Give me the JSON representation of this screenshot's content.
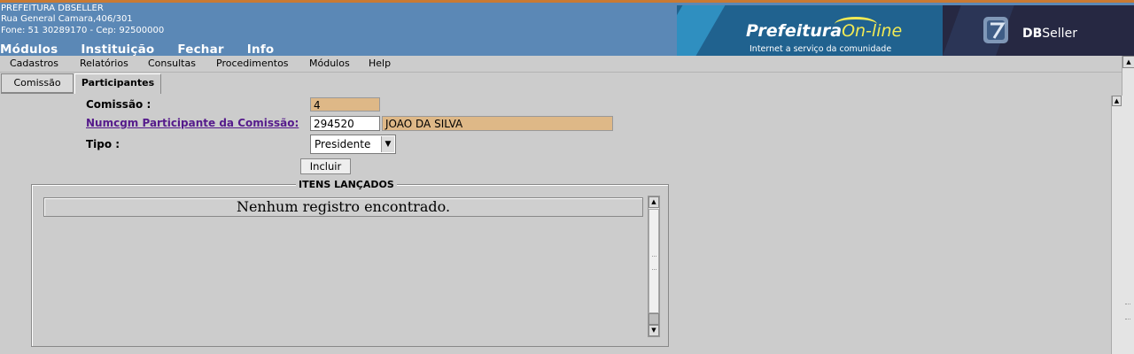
{
  "header": {
    "org_name": "PREFEITURA DBSELLER",
    "org_address": "Rua General Camara,406/301",
    "org_phone": "Fone: 51 30289170  -  Cep: 92500000",
    "nav": [
      "Módulos",
      "Instituição",
      "Fechar",
      "Info"
    ],
    "banner_brand": "Prefeitura",
    "banner_brand_accent": "On-line",
    "banner_tagline": "Internet a serviço da comunidade",
    "vendor_bold": "DB",
    "vendor_rest": "Seller"
  },
  "menubar": [
    "Cadastros",
    "Relatórios",
    "Consultas",
    "Procedimentos",
    "Módulos",
    "Help"
  ],
  "tabs": [
    {
      "label": "Comissão",
      "active": false
    },
    {
      "label": "Participantes",
      "active": true
    }
  ],
  "form": {
    "comissao_label": "Comissão :",
    "comissao_value": "4",
    "numcgm_label": "Numcgm Participante da Comissão:",
    "numcgm_value": "294520",
    "nome_value": "JOAO DA SILVA",
    "tipo_label": "Tipo :",
    "tipo_value": "Presidente",
    "incluir_label": "Incluir"
  },
  "list": {
    "legend": "ITENS LANÇADOS",
    "empty_message": "Nenhum registro encontrado."
  },
  "colors": {
    "header_bg": "#5b88b6",
    "readonly_field": "#deb887",
    "link": "#551a8b",
    "page_bg": "#cccccc"
  }
}
